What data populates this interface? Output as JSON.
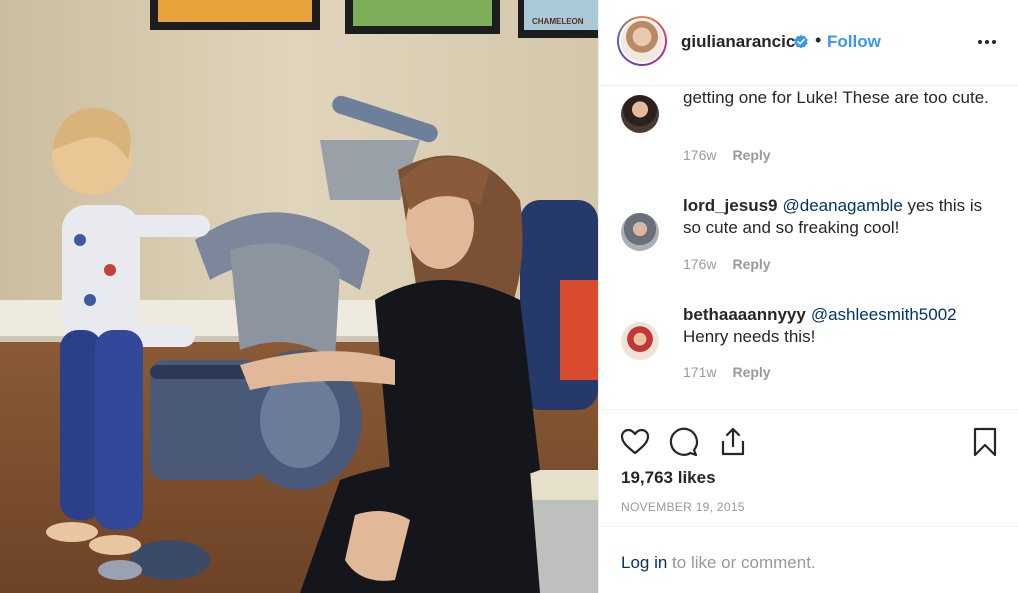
{
  "photo": {
    "alt_label": "",
    "sign_text": "CHAMELEON"
  },
  "header": {
    "username": "giulianarancic",
    "separator": "•",
    "follow_label": "Follow",
    "more_icon": "more-horizontal-icon",
    "verified_icon": "verified-badge-icon"
  },
  "comments": [
    {
      "user": "",
      "mention": "",
      "text": "getting one for Luke! These are too cute.",
      "age": "176w",
      "reply_label": "Reply"
    },
    {
      "user": "lord_jesus9",
      "mention": "@deanagamble",
      "text": " yes this is so cute and so freaking cool!",
      "age": "176w",
      "reply_label": "Reply"
    },
    {
      "user": "bethaaaannyyy",
      "mention": "@ashleesmith5002",
      "text": "Henry needs this!",
      "age": "171w",
      "reply_label": "Reply"
    }
  ],
  "actions": {
    "like_icon": "heart-icon",
    "comment_icon": "comment-icon",
    "share_icon": "share-icon",
    "save_icon": "bookmark-icon",
    "likes": "19,763 likes",
    "date": "NOVEMBER 19, 2015"
  },
  "login": {
    "link_label": "Log in",
    "rest_label": " to like or comment."
  },
  "colors": {
    "link_blue": "#3897f0",
    "mention_blue": "#003569",
    "muted": "#999999",
    "border": "#efefef"
  }
}
